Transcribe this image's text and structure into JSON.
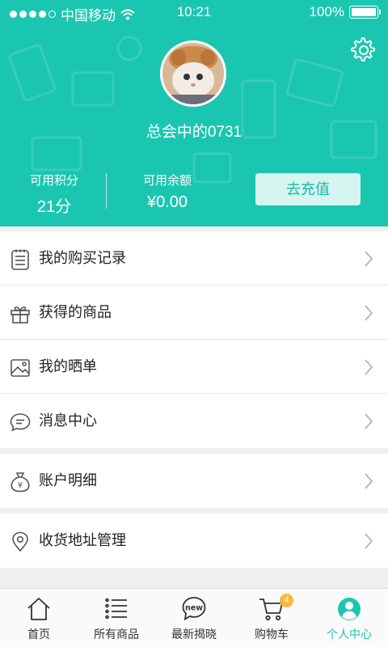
{
  "status_bar": {
    "carrier": "中国移动",
    "time": "10:21",
    "battery": "100%"
  },
  "profile": {
    "username": "总会中的0731",
    "points_label": "可用积分",
    "points_value": "21分",
    "balance_label": "可用余额",
    "balance_value": "¥0.00",
    "recharge_label": "去充值"
  },
  "menu": {
    "purchase_records": "我的购买记录",
    "won_products": "获得的商品",
    "my_shares": "我的晒单",
    "messages": "消息中心",
    "account_details": "账户明细",
    "address_management": "收货地址管理"
  },
  "tabbar": {
    "home": "首页",
    "all_products": "所有商品",
    "latest_reveal": "最新揭晓",
    "new_badge_text": "new",
    "cart": "购物车",
    "cart_count": "4",
    "profile": "个人中心"
  },
  "colors": {
    "primary": "#1bc6b0",
    "badge": "#f6b93b"
  }
}
